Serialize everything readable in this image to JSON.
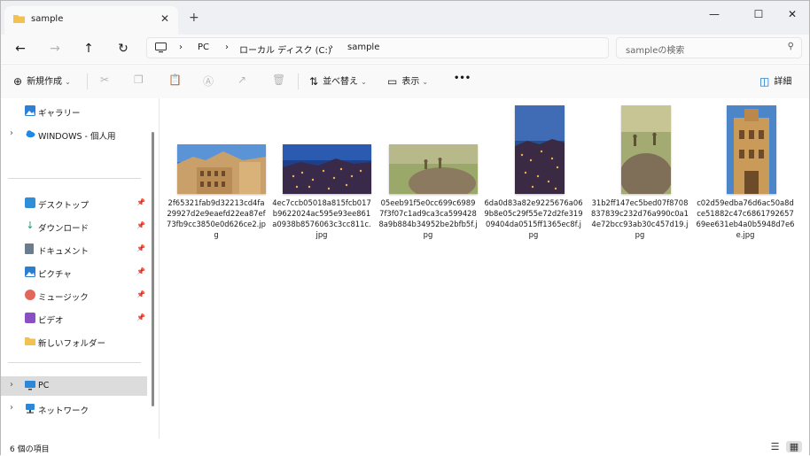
{
  "window": {
    "tab_title": "sample",
    "new_tab": "+",
    "close_tab": "✕",
    "minimize": "—",
    "maximize": "☐",
    "close": "✕"
  },
  "nav": {
    "path": [
      "PC",
      "ローカル ディスク (C:)",
      "sample"
    ],
    "search_placeholder": "sampleの検索"
  },
  "commands": {
    "new": "新規作成",
    "sort": "並べ替え",
    "view": "表示",
    "more": "•••",
    "details": "詳細"
  },
  "sidebar": {
    "gallery": "ギャラリー",
    "onedrive": "WINDOWS - 個人用",
    "quick": [
      {
        "label": "デスクトップ",
        "icon": "desktop-icon",
        "color": "#2e8fd8"
      },
      {
        "label": "ダウンロード",
        "icon": "download-icon",
        "color": "#1f9a7a"
      },
      {
        "label": "ドキュメント",
        "icon": "document-icon",
        "color": "#6b7c8c"
      },
      {
        "label": "ピクチャ",
        "icon": "pictures-icon",
        "color": "#2b7fd0"
      },
      {
        "label": "ミュージック",
        "icon": "music-icon",
        "color": "#e2665a"
      },
      {
        "label": "ビデオ",
        "icon": "video-icon",
        "color": "#8a4fc4"
      },
      {
        "label": "新しいフォルダー",
        "icon": "folder-icon",
        "color": "#f2c14e"
      }
    ],
    "pc": "PC",
    "network": "ネットワーク"
  },
  "files": [
    {
      "name": "2f65321fab9d32213cd4fa29927d2e9eaefd22ea87ef73fb9cc3850e0d626ce2.jpg"
    },
    {
      "name": "4ec7ccb05018a815fcb017b9622024ac595e93ee861a0938b8576063c3cc811c.jpg"
    },
    {
      "name": "05eeb91f5e0cc699c69897f3f07c1ad9ca3ca5994288a9b884b34952be2bfb5f.jpg"
    },
    {
      "name": "6da0d83a82e9225676a069b8e05c29f55e72d2fe31909404da0515ff1365ec8f.jpg"
    },
    {
      "name": "31b2ff147ec5bed07f8708837839c232d76a990c0a14e72bcc93ab30c457d19.jpg"
    },
    {
      "name": "c02d59edba76d6ac50a8dce51882c47c686179265769ee631eb4a0b5948d7e6e.jpg"
    }
  ],
  "status": {
    "count": "6 個の項目"
  },
  "colors": {
    "accent": "#0067c0",
    "folder": "#f2c14e"
  }
}
